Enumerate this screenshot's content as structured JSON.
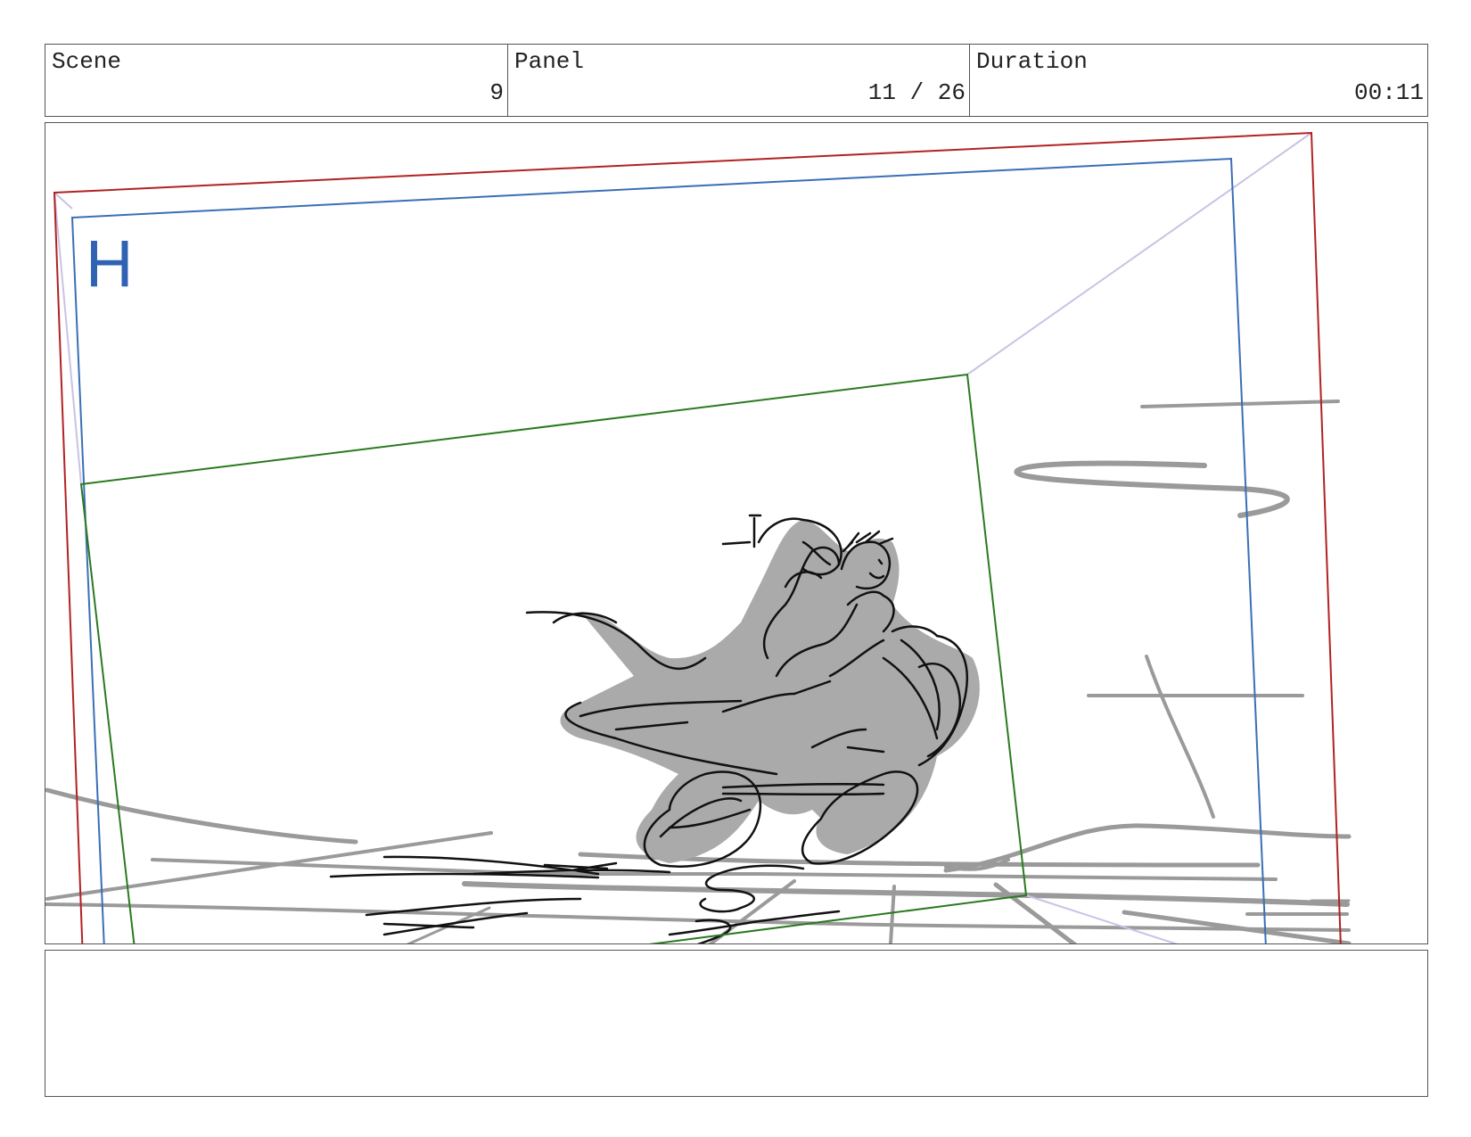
{
  "header": {
    "scene": {
      "label": "Scene",
      "value": "9"
    },
    "panel": {
      "label": "Panel",
      "value": "11 / 26"
    },
    "duration": {
      "label": "Duration",
      "value": "00:11"
    }
  },
  "frame": {
    "marker_letter": "H",
    "colors": {
      "outer_frame": "#b22222",
      "camera_frame": "#3a6fb5",
      "inner_frame": "#2a7a1f",
      "marker": "#2f62b3",
      "sketch_shadow": "#aaaaaa",
      "sketch_line": "#111111",
      "background_lines": "#9a9a9a",
      "guide_lines": "#c8c3e6"
    }
  },
  "notes": {
    "text": ""
  }
}
